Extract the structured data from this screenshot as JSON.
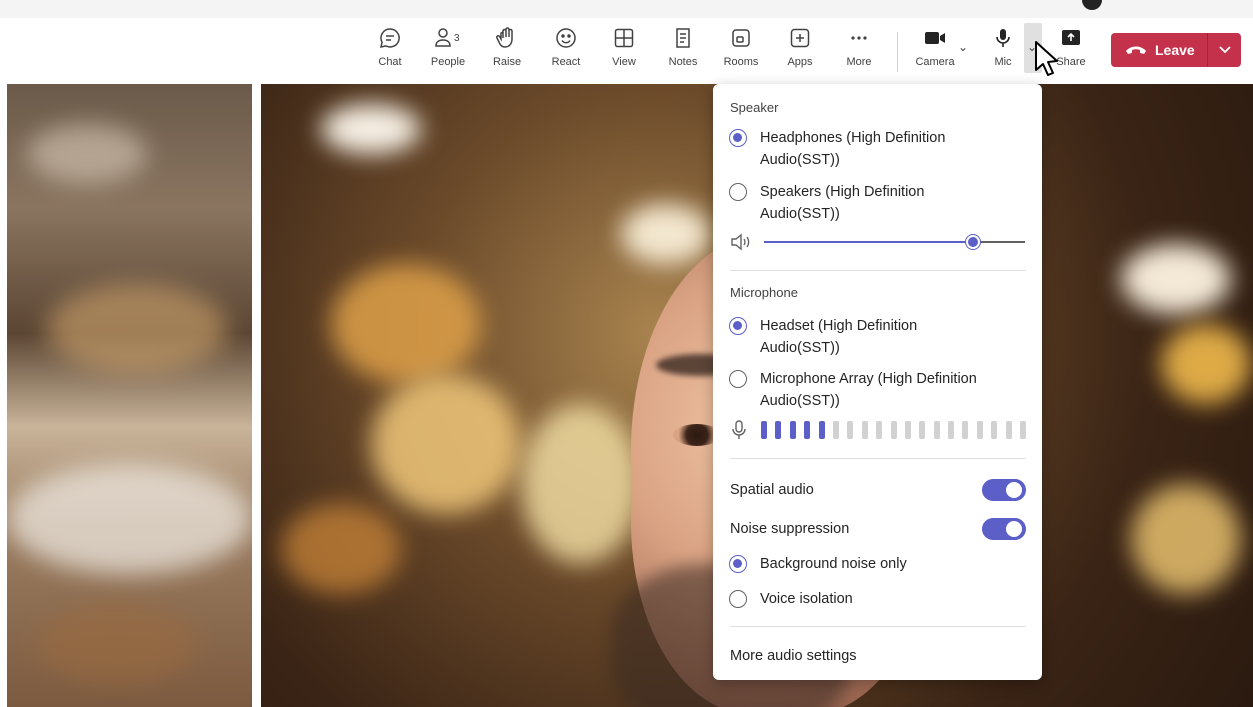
{
  "toolbar": {
    "items": [
      {
        "label": "Chat",
        "icon": "chat-icon"
      },
      {
        "label": "People",
        "icon": "people-icon",
        "badge": "3"
      },
      {
        "label": "Raise",
        "icon": "raise-hand-icon"
      },
      {
        "label": "React",
        "icon": "smile-icon"
      },
      {
        "label": "View",
        "icon": "grid-icon"
      },
      {
        "label": "Notes",
        "icon": "notes-icon"
      },
      {
        "label": "Rooms",
        "icon": "rooms-icon"
      },
      {
        "label": "Apps",
        "icon": "apps-plus-icon"
      },
      {
        "label": "More",
        "icon": "more-dots-icon"
      }
    ],
    "camera_label": "Camera",
    "mic_label": "Mic",
    "share_label": "Share",
    "leave_label": "Leave"
  },
  "audio_panel": {
    "speaker": {
      "title": "Speaker",
      "options": [
        {
          "line1": "Headphones (High Definition",
          "line2": "Audio(SST))",
          "selected": true
        },
        {
          "line1": "Speakers (High Definition",
          "line2": "Audio(SST))",
          "selected": false
        }
      ],
      "volume_fraction": 0.8
    },
    "microphone": {
      "title": "Microphone",
      "options": [
        {
          "line1": "Headset (High Definition",
          "line2": "Audio(SST))",
          "selected": true
        },
        {
          "line1": "Microphone Array (High Definition",
          "line2": "Audio(SST))",
          "selected": false
        }
      ],
      "level_active_segments": 5,
      "level_total_segments": 19
    },
    "spatial_audio": {
      "label": "Spatial audio",
      "on": true
    },
    "noise_suppression": {
      "label": "Noise suppression",
      "on": true,
      "options": [
        {
          "label": "Background noise only",
          "selected": true
        },
        {
          "label": "Voice isolation",
          "selected": false
        }
      ]
    },
    "more_settings_label": "More audio settings"
  },
  "colors": {
    "accent": "#5b5fc7",
    "leave": "#c4314b"
  }
}
